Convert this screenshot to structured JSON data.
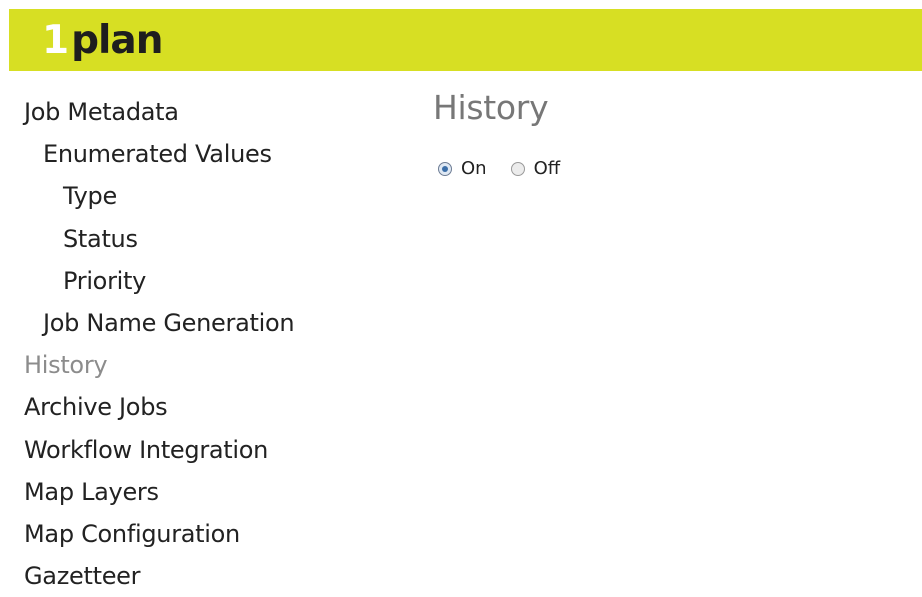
{
  "header": {
    "logo_number": "1",
    "logo_word": "plan",
    "background_color": "#d7df23"
  },
  "nav": {
    "items": [
      {
        "label": "Job Metadata",
        "level": 0,
        "active": false
      },
      {
        "label": "Enumerated Values",
        "level": 1,
        "active": false
      },
      {
        "label": "Type",
        "level": 2,
        "active": false
      },
      {
        "label": "Status",
        "level": 2,
        "active": false
      },
      {
        "label": "Priority",
        "level": 2,
        "active": false
      },
      {
        "label": "Job Name Generation",
        "level": 1,
        "active": false
      },
      {
        "label": "History",
        "level": 0,
        "active": true
      },
      {
        "label": "Archive Jobs",
        "level": 0,
        "active": false
      },
      {
        "label": "Workflow Integration",
        "level": 0,
        "active": false
      },
      {
        "label": "Map Layers",
        "level": 0,
        "active": false
      },
      {
        "label": "Map Configuration",
        "level": 0,
        "active": false
      },
      {
        "label": "Gazetteer",
        "level": 0,
        "active": false
      }
    ]
  },
  "main": {
    "title": "History",
    "history_toggle": {
      "options": [
        {
          "label": "On",
          "selected": true
        },
        {
          "label": "Off",
          "selected": false
        }
      ]
    }
  }
}
